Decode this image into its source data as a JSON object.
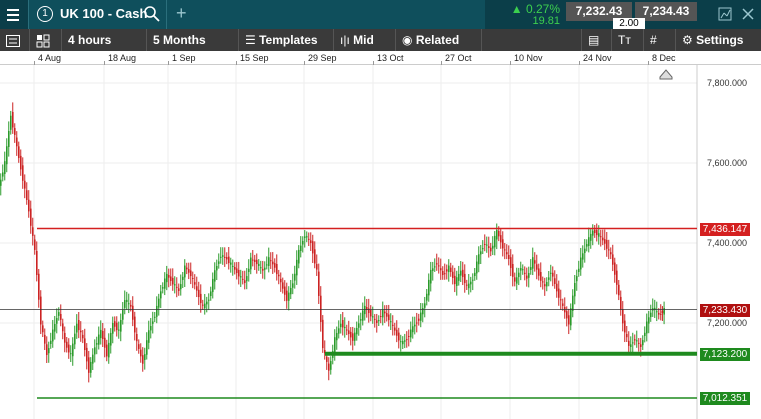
{
  "topbar": {
    "badge": "1",
    "title": "UK 100 - Cash",
    "change_pct": "0.27%",
    "change_abs": "19.81",
    "sell": "7,232.43",
    "buy": "7,234.43",
    "spread": "2.00"
  },
  "toolbar": {
    "interval": "4 hours",
    "range": "5 Months",
    "templates": "Templates",
    "mid": "Mid",
    "related": "Related",
    "settings": "Settings"
  },
  "dates": [
    "4 Aug",
    "18 Aug",
    "1 Sep",
    "15 Sep",
    "29 Sep",
    "13 Oct",
    "27 Oct",
    "10 Nov",
    "24 Nov",
    "8 Dec"
  ],
  "price_labels": {
    "resistance": "7,436.147",
    "current": "7,233.430",
    "support": "7,123.200",
    "low": "7,012.351"
  },
  "colors": {
    "up": "#2a9a2a",
    "down": "#cc2222",
    "resistance": "#d42020",
    "support": "#1e8a1e",
    "current": "#b01010"
  },
  "chart_data": {
    "type": "candlestick",
    "y_ticks": [
      "7,800.000",
      "7,600.000",
      "7,400.000",
      "7,200.000"
    ],
    "ylim": [
      7000,
      7850
    ],
    "series_points": [
      [
        0,
        7540
      ],
      [
        6,
        7600
      ],
      [
        12,
        7720
      ],
      [
        18,
        7640
      ],
      [
        24,
        7560
      ],
      [
        30,
        7480
      ],
      [
        36,
        7380
      ],
      [
        42,
        7200
      ],
      [
        48,
        7120
      ],
      [
        54,
        7180
      ],
      [
        60,
        7230
      ],
      [
        66,
        7150
      ],
      [
        72,
        7120
      ],
      [
        78,
        7200
      ],
      [
        84,
        7160
      ],
      [
        90,
        7080
      ],
      [
        96,
        7140
      ],
      [
        102,
        7180
      ],
      [
        108,
        7120
      ],
      [
        114,
        7200
      ],
      [
        120,
        7180
      ],
      [
        126,
        7260
      ],
      [
        132,
        7240
      ],
      [
        138,
        7150
      ],
      [
        144,
        7100
      ],
      [
        150,
        7180
      ],
      [
        156,
        7220
      ],
      [
        162,
        7280
      ],
      [
        168,
        7320
      ],
      [
        174,
        7300
      ],
      [
        180,
        7280
      ],
      [
        186,
        7340
      ],
      [
        192,
        7320
      ],
      [
        198,
        7280
      ],
      [
        204,
        7240
      ],
      [
        210,
        7260
      ],
      [
        216,
        7330
      ],
      [
        222,
        7370
      ],
      [
        228,
        7360
      ],
      [
        234,
        7340
      ],
      [
        240,
        7320
      ],
      [
        246,
        7300
      ],
      [
        252,
        7360
      ],
      [
        258,
        7350
      ],
      [
        264,
        7330
      ],
      [
        270,
        7360
      ],
      [
        276,
        7340
      ],
      [
        282,
        7300
      ],
      [
        288,
        7260
      ],
      [
        294,
        7300
      ],
      [
        300,
        7380
      ],
      [
        306,
        7420
      ],
      [
        312,
        7400
      ],
      [
        318,
        7330
      ],
      [
        324,
        7140
      ],
      [
        330,
        7080
      ],
      [
        336,
        7160
      ],
      [
        342,
        7200
      ],
      [
        348,
        7180
      ],
      [
        354,
        7160
      ],
      [
        360,
        7200
      ],
      [
        366,
        7240
      ],
      [
        372,
        7220
      ],
      [
        378,
        7200
      ],
      [
        384,
        7230
      ],
      [
        390,
        7210
      ],
      [
        396,
        7180
      ],
      [
        402,
        7150
      ],
      [
        408,
        7160
      ],
      [
        414,
        7190
      ],
      [
        420,
        7210
      ],
      [
        426,
        7250
      ],
      [
        432,
        7330
      ],
      [
        438,
        7350
      ],
      [
        444,
        7320
      ],
      [
        450,
        7340
      ],
      [
        456,
        7300
      ],
      [
        462,
        7330
      ],
      [
        468,
        7290
      ],
      [
        474,
        7310
      ],
      [
        480,
        7370
      ],
      [
        486,
        7400
      ],
      [
        492,
        7380
      ],
      [
        498,
        7430
      ],
      [
        504,
        7390
      ],
      [
        510,
        7360
      ],
      [
        516,
        7300
      ],
      [
        522,
        7340
      ],
      [
        528,
        7310
      ],
      [
        534,
        7360
      ],
      [
        540,
        7320
      ],
      [
        546,
        7290
      ],
      [
        552,
        7330
      ],
      [
        558,
        7280
      ],
      [
        564,
        7240
      ],
      [
        570,
        7200
      ],
      [
        576,
        7300
      ],
      [
        582,
        7360
      ],
      [
        588,
        7400
      ],
      [
        594,
        7430
      ],
      [
        600,
        7420
      ],
      [
        606,
        7400
      ],
      [
        612,
        7370
      ],
      [
        618,
        7300
      ],
      [
        624,
        7200
      ],
      [
        630,
        7140
      ],
      [
        636,
        7160
      ],
      [
        642,
        7140
      ],
      [
        648,
        7200
      ],
      [
        654,
        7240
      ],
      [
        660,
        7220
      ],
      [
        665,
        7233
      ]
    ],
    "levels": [
      7436.147,
      7233.43,
      7123.2,
      7012.351
    ]
  }
}
